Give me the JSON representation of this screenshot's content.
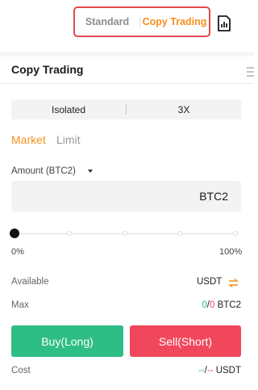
{
  "header": {
    "mode_standard": "Standard",
    "mode_copy_trading": "Copy Trading",
    "active_mode": "Copy Trading",
    "chart_icon": "chart-report-icon",
    "highlight_color": "#e2494f"
  },
  "panel": {
    "title": "Copy Trading",
    "menu_icon": "resize-handle-icon"
  },
  "margin": {
    "mode": "Isolated",
    "leverage": "3X"
  },
  "order_tabs": {
    "market": "Market",
    "limit": "Limit",
    "active": "Market"
  },
  "amount": {
    "label": "Amount (BTC2)",
    "unit": "BTC2",
    "value": ""
  },
  "slider": {
    "min_label": "0%",
    "max_label": "100%",
    "value_percent": 0
  },
  "available": {
    "label": "Available",
    "currency": "USDT",
    "icon": "swap-icon"
  },
  "max": {
    "label": "Max",
    "long": "0",
    "separator": "/",
    "short": "0",
    "unit": "BTC2"
  },
  "buttons": {
    "buy": "Buy(Long)",
    "sell": "Sell(Short)"
  },
  "cost": {
    "label": "Cost",
    "long": "--",
    "separator": "/",
    "short": "--",
    "unit": "USDT"
  },
  "colors": {
    "accent": "#f5901d",
    "buy": "#2ebd85",
    "sell": "#f0475c"
  }
}
